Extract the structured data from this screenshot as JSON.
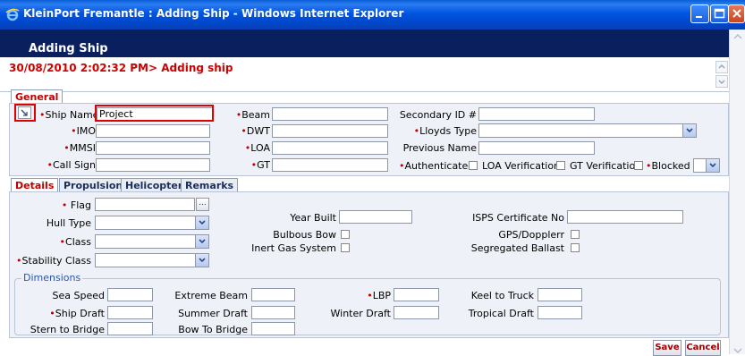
{
  "window": {
    "title": "KleinPort Fremantle : Adding Ship - Windows Internet Explorer"
  },
  "page": {
    "heading": "Adding Ship",
    "status_line": "30/08/2010 2:02:32 PM> Adding ship"
  },
  "top_tabs": [
    {
      "label": "General",
      "active": true
    }
  ],
  "general": {
    "ship_name": {
      "label": "Ship Name",
      "value": "Project"
    },
    "imo": {
      "label": "IMO",
      "value": ""
    },
    "mmsi": {
      "label": "MMSI",
      "value": ""
    },
    "call_sign": {
      "label": "Call Sign",
      "value": ""
    },
    "beam": {
      "label": "Beam",
      "value": ""
    },
    "dwt": {
      "label": "DWT",
      "value": ""
    },
    "loa": {
      "label": "LOA",
      "value": ""
    },
    "gt": {
      "label": "GT",
      "value": ""
    },
    "secondary_id": {
      "label": "Secondary ID #",
      "value": ""
    },
    "lloyds_type": {
      "label": "Lloyds Type",
      "value": ""
    },
    "previous_name": {
      "label": "Previous Name",
      "value": ""
    },
    "authenticated": {
      "label": "Authenticated",
      "checked": false
    },
    "loa_verification": {
      "label": "LOA Verification",
      "checked": false
    },
    "gt_verification": {
      "label": "GT Verification",
      "checked": false
    },
    "blocked": {
      "label": "Blocked",
      "value": ""
    }
  },
  "detail_tabs": [
    {
      "label": "Details",
      "active": true
    },
    {
      "label": "Propulsion",
      "active": false
    },
    {
      "label": "Helicopter",
      "active": false
    },
    {
      "label": "Remarks",
      "active": false
    }
  ],
  "details": {
    "flag": {
      "label": "Flag",
      "value": "",
      "lookup_glyph": "..."
    },
    "hull_type": {
      "label": "Hull Type",
      "value": ""
    },
    "class": {
      "label": "Class",
      "value": ""
    },
    "stability_class": {
      "label": "Stability Class",
      "value": ""
    },
    "year_built": {
      "label": "Year Built",
      "value": ""
    },
    "bulbous_bow": {
      "label": "Bulbous Bow",
      "checked": false
    },
    "inert_gas_system": {
      "label": "Inert Gas System",
      "checked": false
    },
    "isps_certificate_no": {
      "label": "ISPS Certificate No",
      "value": ""
    },
    "gps_dopplerr": {
      "label": "GPS/Dopplerr",
      "checked": false
    },
    "segregated_ballast": {
      "label": "Segregated Ballast",
      "checked": false
    }
  },
  "dimensions": {
    "legend": "Dimensions",
    "sea_speed": {
      "label": "Sea Speed",
      "value": ""
    },
    "extreme_beam": {
      "label": "Extreme Beam",
      "value": ""
    },
    "lbp": {
      "label": "LBP",
      "value": ""
    },
    "keel_to_truck": {
      "label": "Keel to Truck",
      "value": ""
    },
    "ship_draft": {
      "label": "Ship Draft",
      "value": ""
    },
    "summer_draft": {
      "label": "Summer Draft",
      "value": ""
    },
    "winter_draft": {
      "label": "Winter Draft",
      "value": ""
    },
    "tropical_draft": {
      "label": "Tropical Draft",
      "value": ""
    },
    "stern_to_bridge": {
      "label": "Stern to Bridge",
      "value": ""
    },
    "bow_to_bridge": {
      "label": "Bow To Bridge",
      "value": ""
    }
  },
  "actions": {
    "save": "Save",
    "cancel": "Cancel"
  },
  "required_marker": "•",
  "icons": {
    "browser": "ie-icon",
    "minimize": "minimize-icon",
    "maximize": "maximize-icon",
    "close": "close-icon",
    "lookup": "search-lookup-icon",
    "dropdown": "chevron-down-icon"
  },
  "colors": {
    "titlebar": "#0054e3",
    "header_band": "#0a1f5e",
    "status_text": "#d00000",
    "required": "#c00000",
    "highlight_box": "#e00000",
    "legend": "#2c55a8"
  }
}
